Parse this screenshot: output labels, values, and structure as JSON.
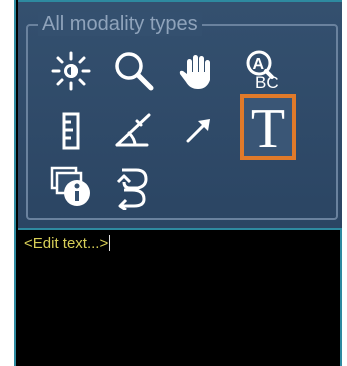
{
  "panel": {
    "group_title": "All modality types",
    "tools": [
      {
        "id": "window-level",
        "icon": "brightness-icon",
        "selected": false
      },
      {
        "id": "zoom",
        "icon": "magnifier-icon",
        "selected": false
      },
      {
        "id": "pan",
        "icon": "hand-icon",
        "selected": false
      },
      {
        "id": "spellcheck",
        "icon": "spellcheck-icon",
        "selected": false
      },
      {
        "id": "ruler",
        "icon": "ruler-icon",
        "selected": false
      },
      {
        "id": "angle",
        "icon": "angle-icon",
        "selected": false
      },
      {
        "id": "arrow",
        "icon": "arrow-icon",
        "selected": false
      },
      {
        "id": "text",
        "icon": "text-icon",
        "selected": true
      },
      {
        "id": "info",
        "icon": "info-icon",
        "selected": false
      },
      {
        "id": "rotate",
        "icon": "rotate-icon",
        "selected": false
      }
    ],
    "text_tool_glyph": "T",
    "spellcheck_glyph_top": "A",
    "spellcheck_glyph_bottom": "BC"
  },
  "editor": {
    "text": "<Edit text...>"
  },
  "colors": {
    "panel_bg": "#34506f",
    "selection_border": "#e07a2a",
    "editor_text": "#d8cf57",
    "frame_border": "#2e8aa0"
  }
}
